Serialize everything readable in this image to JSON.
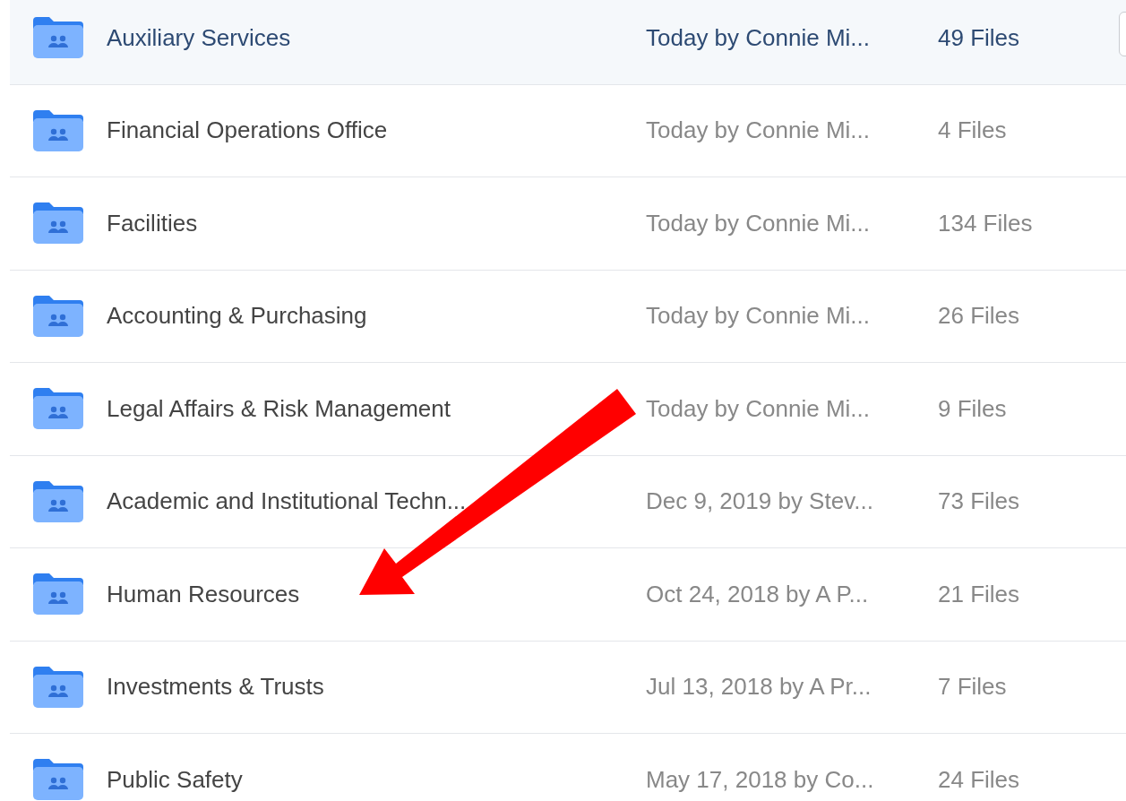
{
  "folders": [
    {
      "name": "Auxiliary Services",
      "updated": "Today by Connie Mi...",
      "count": "49 Files",
      "selected": true
    },
    {
      "name": "Financial Operations Office",
      "updated": "Today by Connie Mi...",
      "count": "4 Files",
      "selected": false
    },
    {
      "name": "Facilities",
      "updated": "Today by Connie Mi...",
      "count": "134 Files",
      "selected": false
    },
    {
      "name": "Accounting & Purchasing",
      "updated": "Today by Connie Mi...",
      "count": "26 Files",
      "selected": false
    },
    {
      "name": "Legal Affairs & Risk Management",
      "updated": "Today by Connie Mi...",
      "count": "9 Files",
      "selected": false
    },
    {
      "name": "Academic and Institutional Techn...",
      "updated": "Dec 9, 2019 by Stev...",
      "count": "73 Files",
      "selected": false
    },
    {
      "name": "Human Resources",
      "updated": "Oct 24, 2018 by A P...",
      "count": "21 Files",
      "selected": false
    },
    {
      "name": "Investments & Trusts",
      "updated": "Jul 13, 2018 by A Pr...",
      "count": "7 Files",
      "selected": false
    },
    {
      "name": "Public Safety",
      "updated": "May 17, 2018 by Co...",
      "count": "24 Files",
      "selected": false
    }
  ]
}
